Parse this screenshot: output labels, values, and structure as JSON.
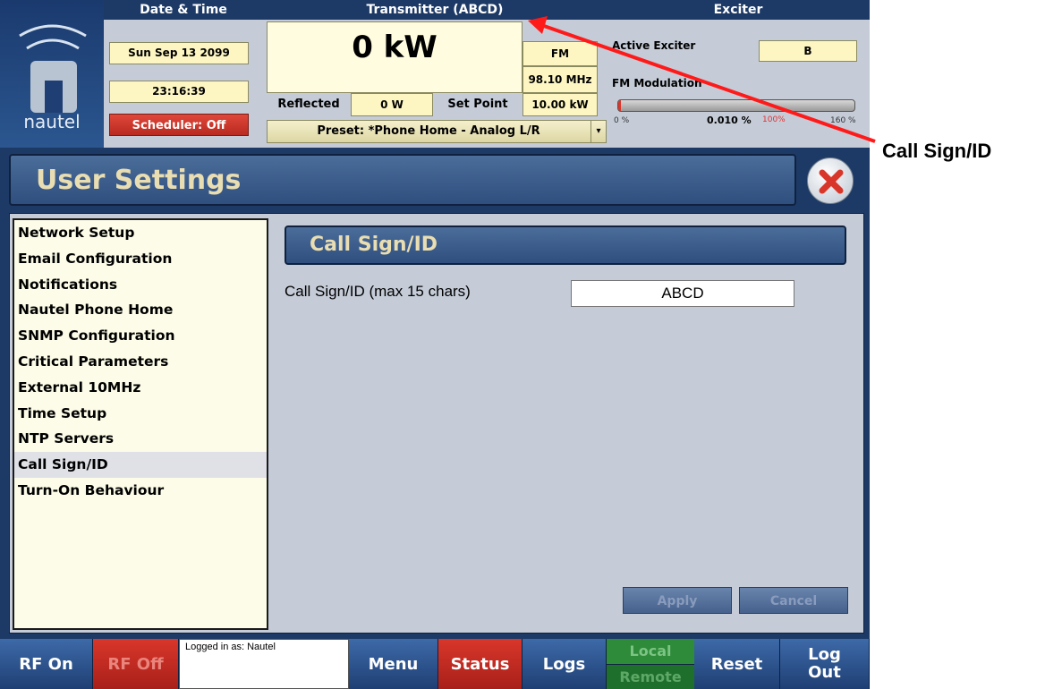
{
  "header": {
    "date_time_title": "Date & Time",
    "date": "Sun Sep 13 2099",
    "time": "23:16:39",
    "scheduler": "Scheduler: Off",
    "brand": "nautel",
    "transmitter_title": "Transmitter (ABCD)",
    "power": "0 kW",
    "mode": "FM",
    "frequency": "98.10 MHz",
    "reflected_label": "Reflected",
    "reflected_value": "0 W",
    "setpoint_label": "Set Point",
    "setpoint_value": "10.00 kW",
    "preset": "Preset: *Phone Home - Analog L/R",
    "exciter_title": "Exciter",
    "active_exciter_label": "Active Exciter",
    "active_exciter_value": "B",
    "fm_modulation_label": "FM Modulation",
    "mod_tick_0": "0 %",
    "mod_value": "0.010 %",
    "mod_tick_100": "100%",
    "mod_tick_160": "160 %"
  },
  "page": {
    "title": "User Settings"
  },
  "nav": {
    "items": [
      {
        "label": "Network Setup"
      },
      {
        "label": "Email Configuration"
      },
      {
        "label": "Notifications"
      },
      {
        "label": "Nautel Phone Home"
      },
      {
        "label": "SNMP Configuration"
      },
      {
        "label": "Critical Parameters"
      },
      {
        "label": "External 10MHz"
      },
      {
        "label": "Time Setup"
      },
      {
        "label": "NTP Servers"
      },
      {
        "label": "Call Sign/ID"
      },
      {
        "label": "Turn-On Behaviour"
      }
    ]
  },
  "section": {
    "title": "Call Sign/ID",
    "field_label": "Call Sign/ID (max 15 chars)",
    "field_value": "ABCD",
    "apply": "Apply",
    "cancel": "Cancel"
  },
  "bottom": {
    "rf_on": "RF On",
    "rf_off": "RF Off",
    "logged_in": "Logged in as: Nautel",
    "menu": "Menu",
    "status": "Status",
    "logs": "Logs",
    "local": "Local",
    "remote": "Remote",
    "reset": "Reset",
    "logout": "Log Out"
  },
  "annotation": {
    "label": "Call Sign/ID"
  },
  "colors": {
    "accent_red": "#d9362a",
    "nav_blue": "#1f3f74",
    "panel_bg": "#c5ccd8",
    "cream": "#fdf6c3"
  }
}
